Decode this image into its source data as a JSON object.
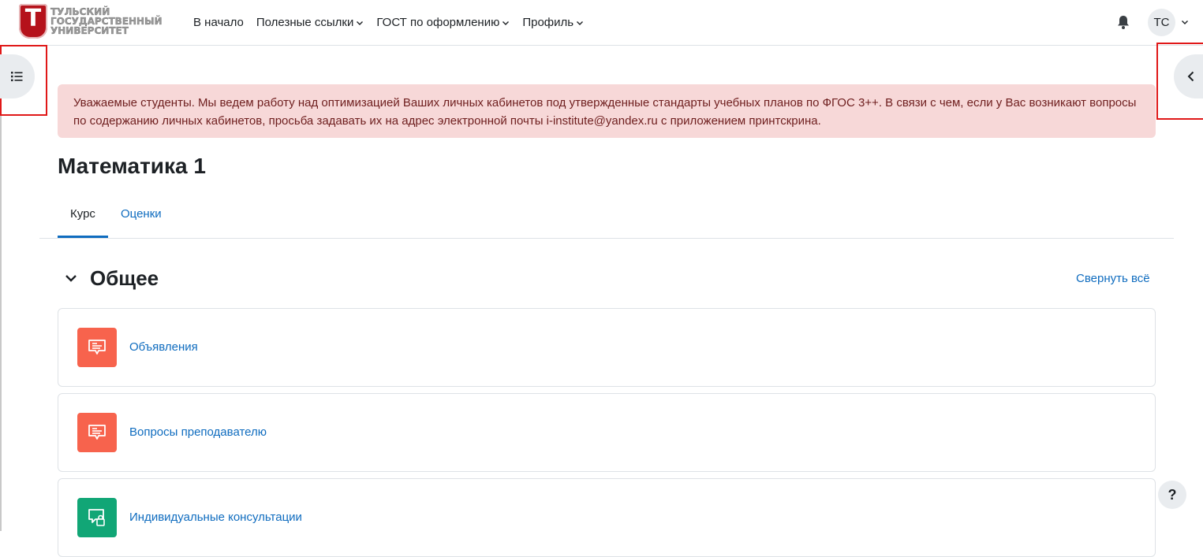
{
  "logo": {
    "letter": "Т",
    "lines": [
      "ТУЛЬСКИЙ",
      "ГОСУДАРСТВЕННЫЙ",
      "УНИВЕРСИТЕТ"
    ]
  },
  "nav": {
    "items": [
      {
        "label": "В начало",
        "dropdown": false
      },
      {
        "label": "Полезные ссылки",
        "dropdown": true
      },
      {
        "label": "ГОСТ по оформлению",
        "dropdown": true
      },
      {
        "label": "Профиль",
        "dropdown": true
      }
    ],
    "notification_icon": "bell-icon",
    "user_initials": "ТС"
  },
  "alert": {
    "text": "Уважаемые студенты. Мы ведем работу над оптимизацией Ваших личных кабинетов под утвержденные стандарты учебных планов по ФГОС 3++. В связи с чем, если у Вас возникают вопросы по содержанию личных кабинетов, просьба задавать их на адрес электронной почты i-institute@yandex.ru с приложением принтскрина."
  },
  "course": {
    "title": "Математика 1",
    "tabs": [
      {
        "label": "Курс",
        "active": true
      },
      {
        "label": "Оценки",
        "active": false
      }
    ]
  },
  "section": {
    "title": "Общее",
    "collapse_all_label": "Свернуть всё",
    "activities": [
      {
        "label": "Объявления",
        "icon": "forum-icon",
        "color": "#f7634d"
      },
      {
        "label": "Вопросы преподавателю",
        "icon": "forum-icon",
        "color": "#f7634d"
      },
      {
        "label": "Индивидуальные консультации",
        "icon": "chat-icon",
        "color": "#11a676"
      }
    ]
  },
  "help": {
    "label": "?"
  },
  "colors": {
    "link": "#0f6cbf",
    "alert_bg": "#f7d8d8",
    "highlight_border": "#e01818"
  }
}
